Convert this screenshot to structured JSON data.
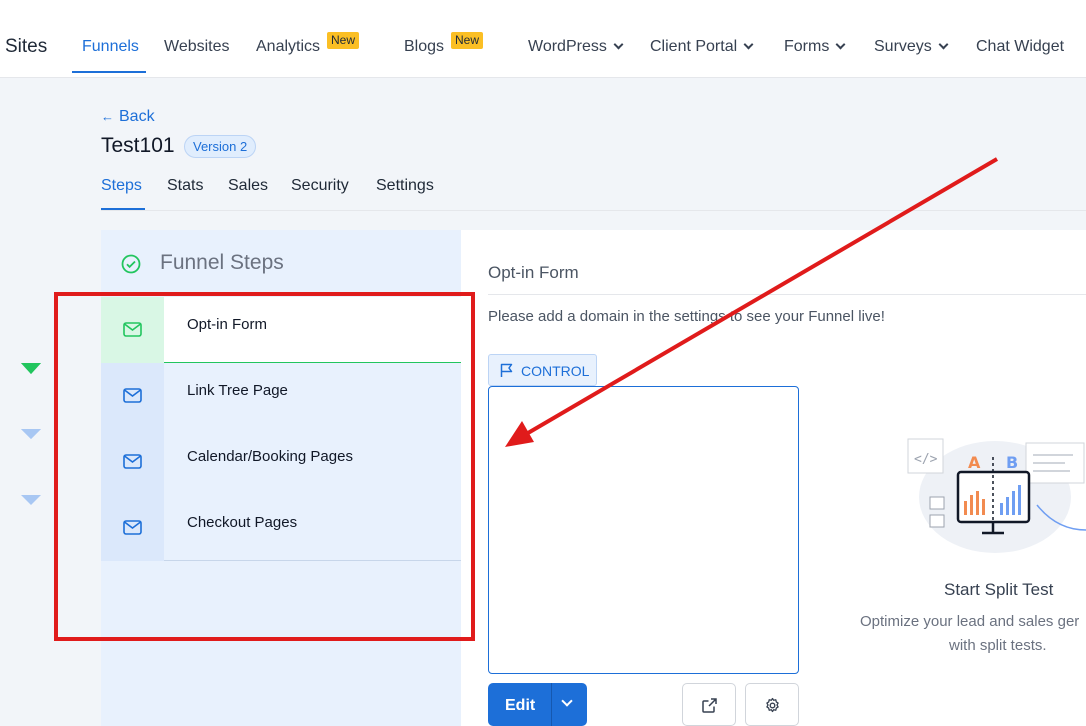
{
  "topnav": {
    "brand": "Sites",
    "items": [
      {
        "label": "Funnels"
      },
      {
        "label": "Websites"
      },
      {
        "label": "Analytics",
        "badge": "New"
      },
      {
        "label": "Blogs",
        "badge": "New"
      },
      {
        "label": "WordPress"
      },
      {
        "label": "Client Portal"
      },
      {
        "label": "Forms"
      },
      {
        "label": "Surveys"
      },
      {
        "label": "Chat Widget"
      }
    ],
    "active_item": "Funnels"
  },
  "header": {
    "back_label": "Back",
    "title": "Test101",
    "version_badge": "Version 2",
    "tabs": [
      {
        "label": "Steps"
      },
      {
        "label": "Stats"
      },
      {
        "label": "Sales"
      },
      {
        "label": "Security"
      },
      {
        "label": "Settings"
      }
    ],
    "active_tab": "Steps"
  },
  "funnel_steps": {
    "title": "Funnel Steps",
    "steps": [
      {
        "label": "Opt-in Form",
        "icon": "mail-icon"
      },
      {
        "label": "Link Tree Page",
        "icon": "mail-icon"
      },
      {
        "label": "Calendar/Booking Pages",
        "icon": "mail-icon"
      },
      {
        "label": "Checkout Pages",
        "icon": "mail-icon"
      }
    ],
    "active_step": "Opt-in Form"
  },
  "main": {
    "step_title": "Opt-in Form",
    "notice": "Please add a domain in the settings to see your Funnel live!",
    "control_label": "CONTROL",
    "edit_label": "Edit"
  },
  "split_test": {
    "title": "Start Split Test",
    "desc_line1": "Optimize your lead and sales ger",
    "desc_line2": "with split tests.",
    "illustration_letters": [
      "A",
      "B"
    ]
  },
  "colors": {
    "accent": "#1d6fd8",
    "active_step_green": "#22c55e",
    "annotation_red": "#e01b1b",
    "badge_yellow": "#fbbf24"
  }
}
